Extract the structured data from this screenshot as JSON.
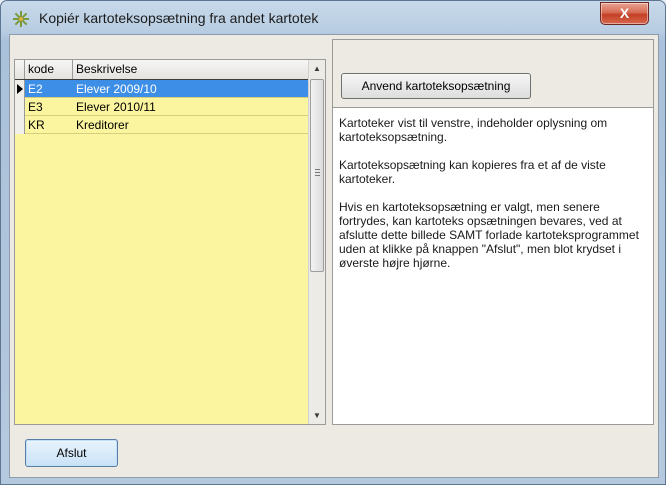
{
  "window": {
    "title": "Kopiér kartoteksopsætning fra andet kartotek",
    "close_glyph": "X",
    "app_icon": "gear-flower-icon"
  },
  "grid": {
    "columns": [
      "kode",
      "Beskrivelse"
    ],
    "rows": [
      {
        "kode": "E2",
        "beskrivelse": "Elever 2009/10",
        "selected": true
      },
      {
        "kode": "E3",
        "beskrivelse": "Elever 2010/11",
        "selected": false
      },
      {
        "kode": "KR",
        "beskrivelse": "Kreditorer",
        "selected": false
      }
    ],
    "scroll_up_glyph": "▲",
    "scroll_down_glyph": "▼"
  },
  "right_panel": {
    "apply_button_label": "Anvend kartoteksopsætning",
    "info_paragraphs": [
      "Kartoteker vist til venstre, indeholder oplysning om kartoteksopsætning.",
      "Kartoteksopsætning kan kopieres fra et af de viste kartoteker.",
      "Hvis en kartoteksopsætning er valgt, men senere fortrydes, kan kartoteks opsætningen bevares, ved at afslutte dette billede SAMT forlade kartoteksprogrammet uden at klikke på knappen \"Afslut\", men blot krydset i øverste højre hjørne."
    ]
  },
  "footer": {
    "close_button_label": "Afslut"
  },
  "colors": {
    "grid_background": "#fbf59f",
    "selection": "#3d8ee6",
    "close_button": "#c43f25"
  }
}
